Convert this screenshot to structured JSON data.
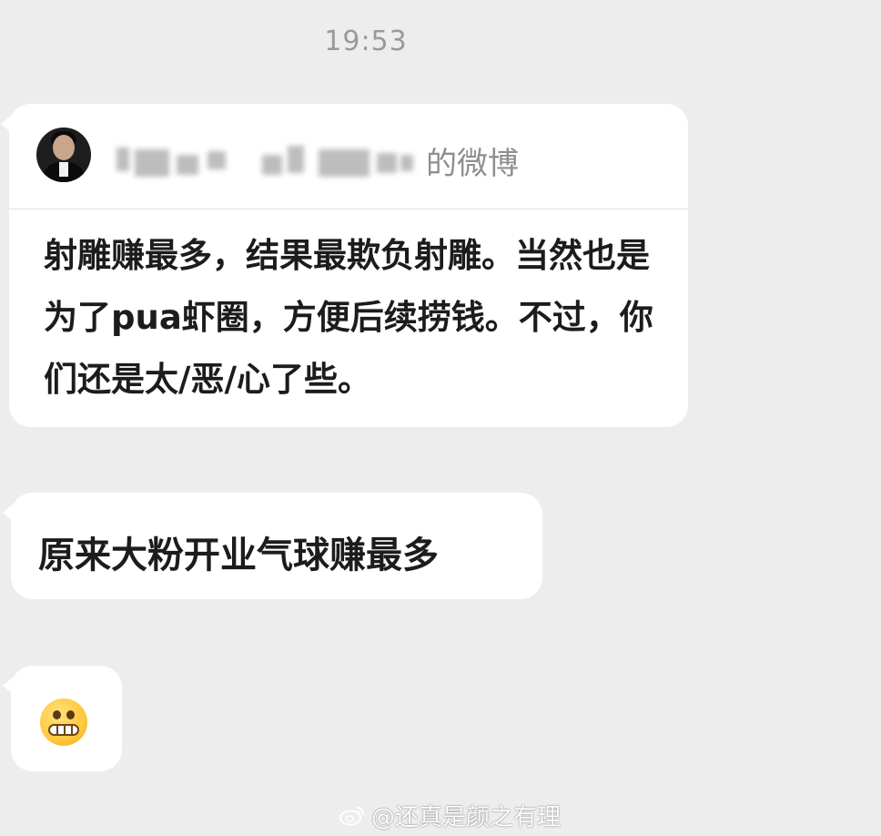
{
  "status": {
    "time": "19:53"
  },
  "shared_card": {
    "avatar_icon": "profile-avatar",
    "author_name_blurred": "",
    "author_suffix": "的微博",
    "body": "射雕赚最多，结果最欺负射雕。当然也是为了pua虾圈，方便后续捞钱。不过，你们还是太/恶/心了些。"
  },
  "messages": [
    {
      "type": "text",
      "text": "原来大粉开业气球赚最多"
    },
    {
      "type": "emoji",
      "icon": "grinning-face-icon"
    }
  ],
  "watermark": {
    "icon": "weibo-logo-icon",
    "text": "@还真是颜之有理"
  },
  "colors": {
    "background": "#ededed",
    "bubble": "#ffffff",
    "timestamp": "#9a9a9a"
  }
}
